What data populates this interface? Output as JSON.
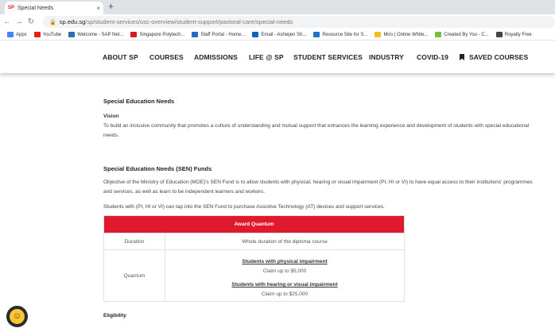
{
  "browser": {
    "tab_favicon": "SP",
    "tab_title": "Special Needs",
    "tab_close": "×",
    "new_tab": "+",
    "url_host": "sp.edu.sg",
    "url_path": "/sp/student-services/osc-overview/student-support/pastoral-care/special-needs"
  },
  "bookmarks": [
    {
      "label": "Apps",
      "color": "#4285f4"
    },
    {
      "label": "YouTube",
      "color": "#e62117"
    },
    {
      "label": "Welcome - SAP Net...",
      "color": "#2f6db5"
    },
    {
      "label": "Singapore Polytech...",
      "color": "#d71920"
    },
    {
      "label": "Staff Portal - Home...",
      "color": "#1f6fc5"
    },
    {
      "label": "Email - Ashiejen Sh...",
      "color": "#0b64c0"
    },
    {
      "label": "Resource Site for S...",
      "color": "#1c73c9"
    },
    {
      "label": "Miro | Online White...",
      "color": "#f2c01e"
    },
    {
      "label": "Created By You - C...",
      "color": "#7cbc42"
    },
    {
      "label": "Royalty Free",
      "color": "#444444"
    }
  ],
  "site_nav": {
    "about": "ABOUT SP",
    "courses": "COURSES",
    "admissions": "ADMISSIONS",
    "life": "LIFE @ SP",
    "student_services": "STUDENT SERVICES",
    "industry": "INDUSTRY",
    "covid": "COVID-19",
    "saved": "SAVED COURSES"
  },
  "content": {
    "title": "Special Education Needs",
    "vision_heading": "Vision",
    "vision_text": "To build an inclusive community that promotes a culture of understanding and mutual support that enhances the learning experience and development of students with special educational needs.",
    "fund_title": "Special Education Needs (SEN) Funds",
    "fund_text": "Objective of the Ministry of Education (MOE)'s SEN Fund is to allow students with physical, hearing or visual impairment (PI, HI or VI) to have equal access to their institutions' programmes and services, as well as learn to be independent learners and workers.",
    "fund_text2": "Students with (PI, HI or VI) can tap into the SEN Fund to purchase Assistive Technology (AT) devices and support services.",
    "table": {
      "header": "Award Quantum",
      "row1_label": "Duration",
      "row1_value": "Whole duration of the diploma course",
      "row2_label": "Quantum",
      "physical_heading": "Students with physical impairment",
      "physical_amount": "Claim up to $5,000",
      "hearing_heading": "Students with hearing or visual impairment",
      "hearing_amount": "Claim up to $25,000"
    },
    "eligibility": "Eligibility"
  }
}
